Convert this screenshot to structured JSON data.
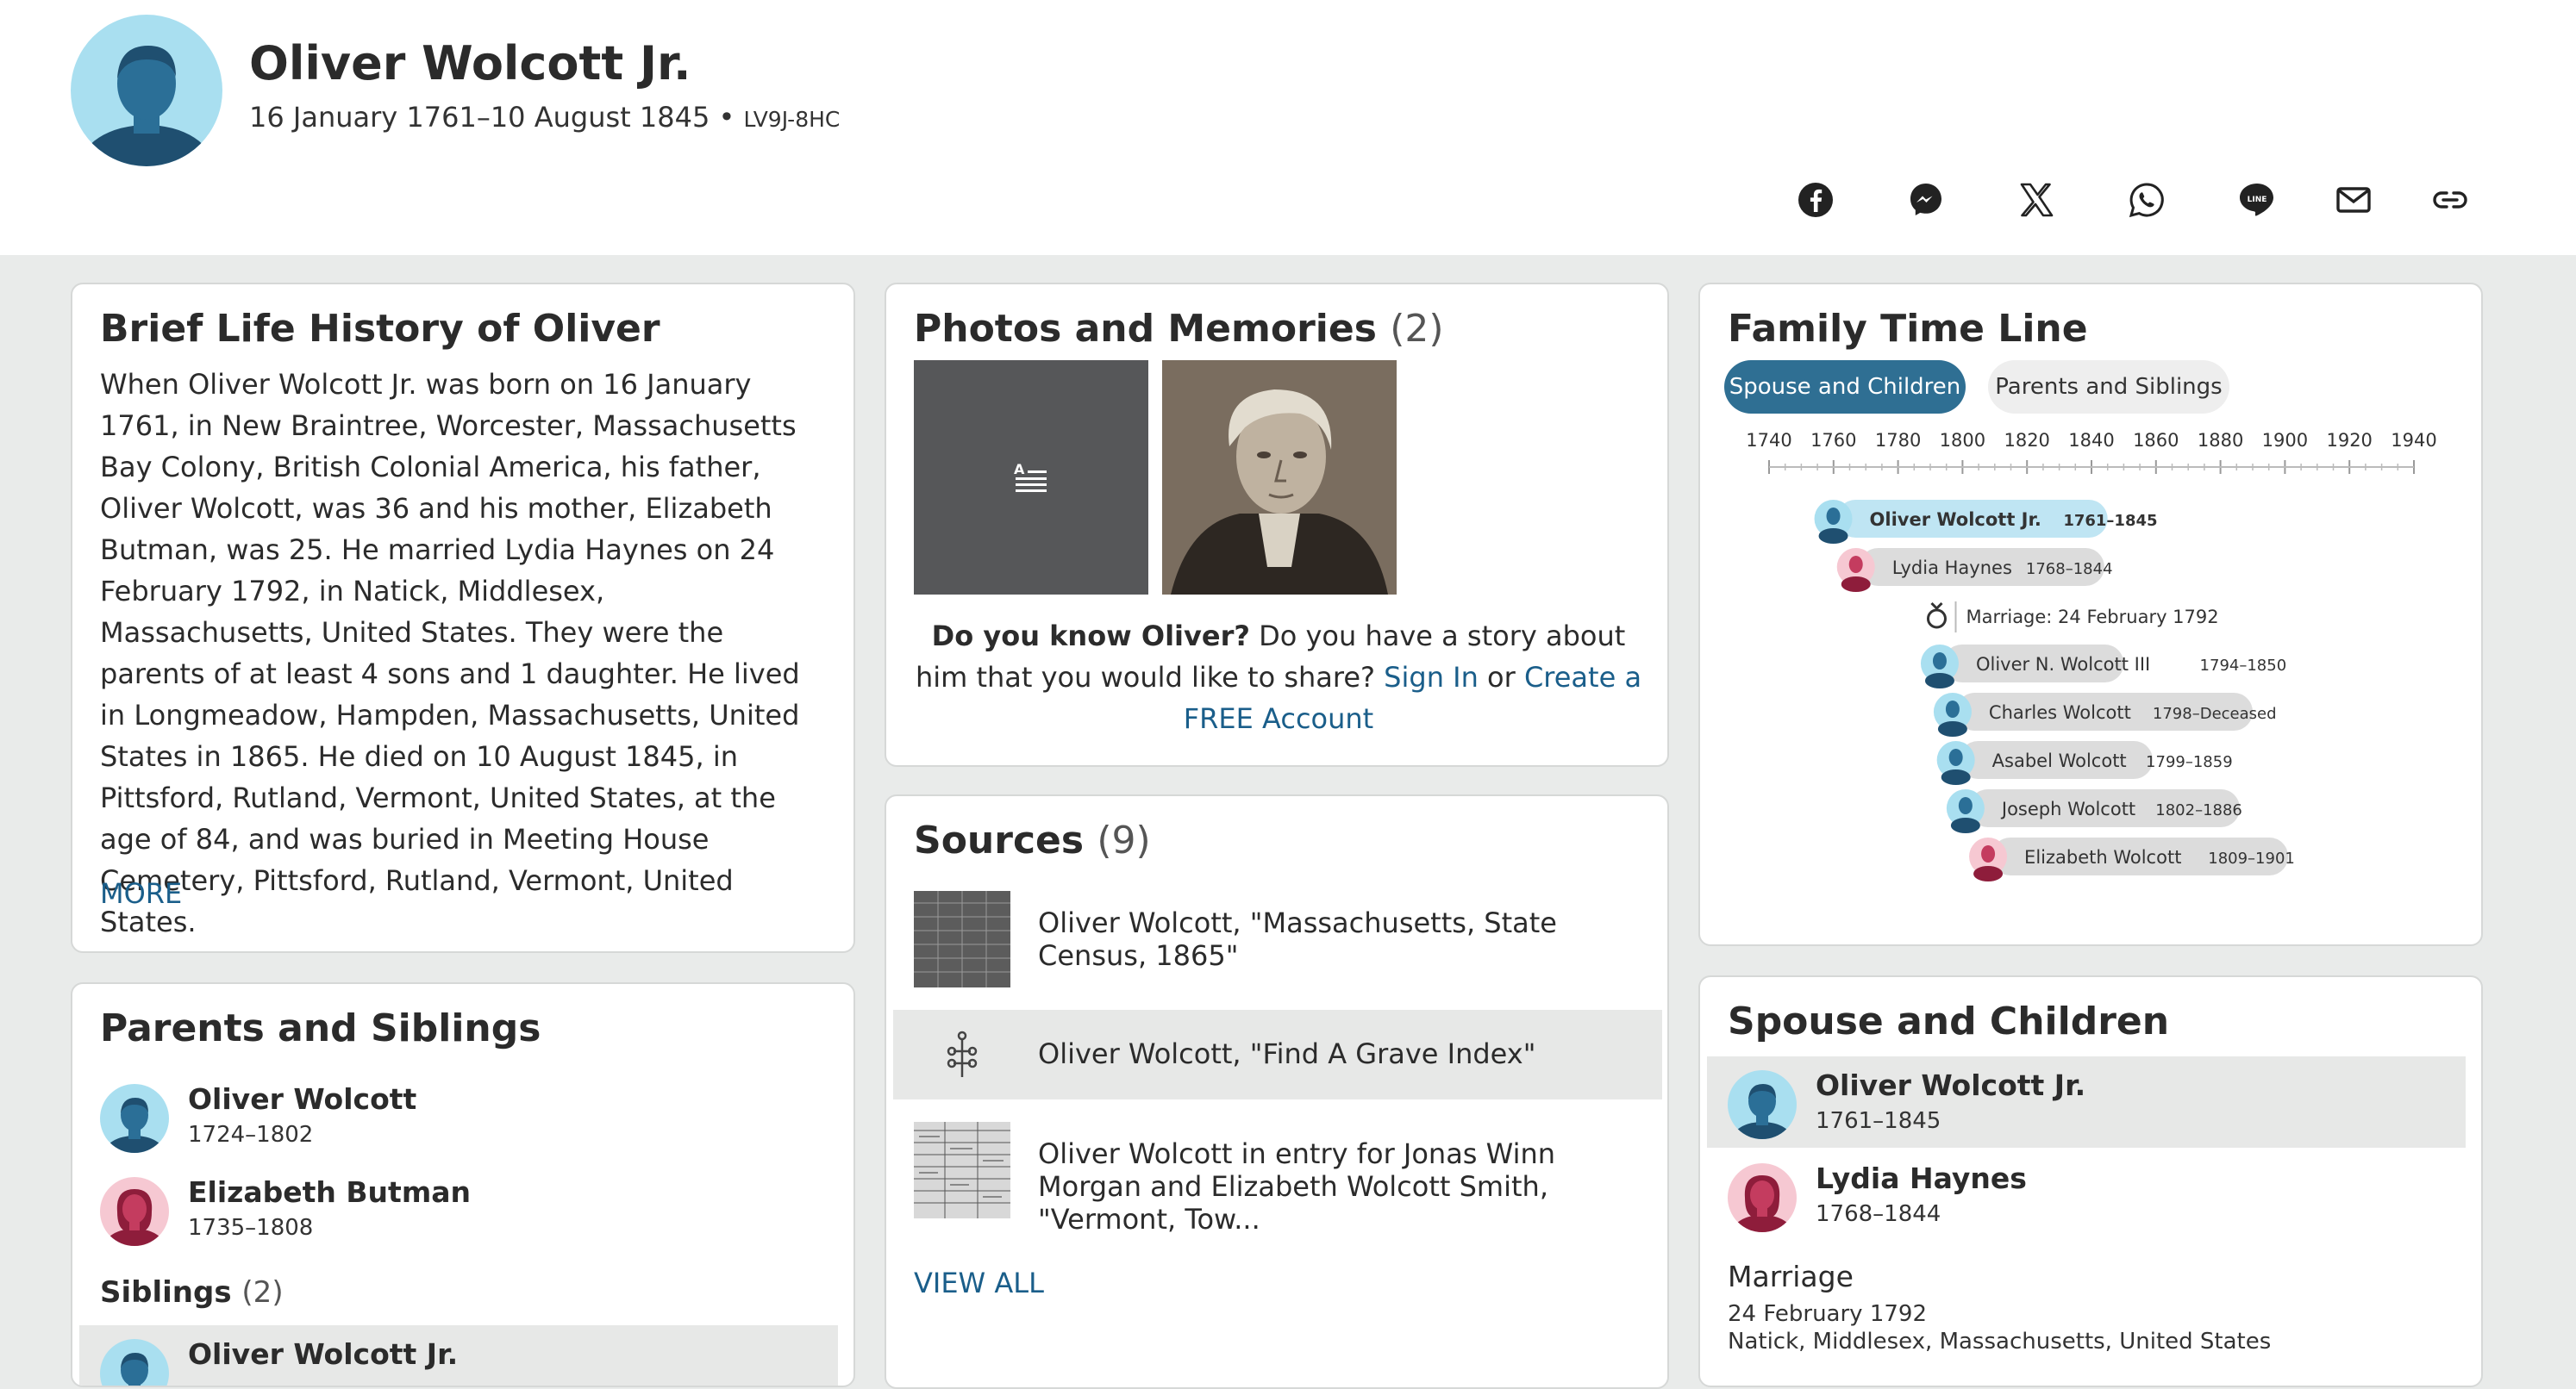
{
  "person": {
    "name": "Oliver Wolcott Jr.",
    "lifespan": "16 January 1761–10 August 1845",
    "separator": " • ",
    "pid": "LV9J-8HC"
  },
  "share": [
    "facebook-icon",
    "messenger-icon",
    "x-icon",
    "whatsapp-icon",
    "line-icon",
    "email-icon",
    "link-icon"
  ],
  "life_history": {
    "title": "Brief Life History of Oliver",
    "text": "When Oliver Wolcott Jr. was born on 16 January 1761, in New Braintree, Worcester, Massachusetts Bay Colony, British Colonial America, his father, Oliver Wolcott, was 36 and his mother, Elizabeth Butman, was 25. He married Lydia Haynes on 24 February 1792, in Natick, Middlesex, Massachusetts, United States. They were the parents of at least 4 sons and 1 daughter. He lived in Longmeadow, Hampden, Massachusetts, United States in 1865. He died on 10 August 1845, in Pittsford, Rutland, Vermont, United States, at the age of 84, and was buried in Meeting House Cemetery, Pittsford, Rutland, Vermont, United States.",
    "more": "MORE"
  },
  "photos": {
    "title": "Photos and Memories",
    "count": "(2)",
    "know_bold": "Do you know Oliver?",
    "know_text": " Do you have a story about him that you would like to share? ",
    "sign_in": "Sign In",
    "or": " or ",
    "create": "Create a FREE Account"
  },
  "sources": {
    "title": "Sources",
    "count": "(9)",
    "items": [
      "Oliver Wolcott, \"Massachusetts, State Census, 1865\"",
      "Oliver Wolcott, \"Find A Grave Index\"",
      "Oliver Wolcott in entry for Jonas Winn Morgan and Elizabeth Wolcott Smith, \"Vermont, Tow..."
    ],
    "view_all": "VIEW ALL"
  },
  "parents": {
    "title": "Parents and Siblings",
    "items": [
      {
        "name": "Oliver Wolcott",
        "dates": "1724–1802"
      },
      {
        "name": "Elizabeth Butman",
        "dates": "1735–1808"
      }
    ],
    "siblings_label": "Siblings",
    "siblings_count": "(2)",
    "sibling_first": {
      "name": "Oliver Wolcott Jr."
    }
  },
  "timeline": {
    "title": "Family Time Line",
    "tabs": [
      "Spouse and Children",
      "Parents and Siblings"
    ],
    "ticks": [
      1740,
      1760,
      1780,
      1800,
      1820,
      1840,
      1860,
      1880,
      1900,
      1920,
      1940
    ],
    "entries": [
      {
        "name": "Oliver Wolcott Jr.",
        "dates": "1761–1845",
        "start": 1761,
        "end": 1845,
        "gender": "m",
        "focus": true
      },
      {
        "name": "Lydia Haynes",
        "dates": "1768–1844",
        "start": 1768,
        "end": 1844,
        "gender": "f"
      },
      {
        "marriage": "Marriage: 24 February 1792",
        "year": 1792
      },
      {
        "name": "Oliver N. Wolcott III",
        "dates": "1794–1850",
        "start": 1794,
        "end": 1850,
        "gender": "m"
      },
      {
        "name": "Charles Wolcott",
        "dates": "1798–Deceased",
        "start": 1798,
        "end": 1890,
        "gender": "m"
      },
      {
        "name": "Asabel Wolcott",
        "dates": "1799–1859",
        "start": 1799,
        "end": 1859,
        "gender": "m"
      },
      {
        "name": "Joseph Wolcott",
        "dates": "1802–1886",
        "start": 1802,
        "end": 1886,
        "gender": "m"
      },
      {
        "name": "Elizabeth Wolcott",
        "dates": "1809–1901",
        "start": 1809,
        "end": 1901,
        "gender": "f"
      }
    ]
  },
  "spouse": {
    "title": "Spouse and Children",
    "items": [
      {
        "name": "Oliver Wolcott Jr.",
        "dates": "1761–1845"
      },
      {
        "name": "Lydia Haynes",
        "dates": "1768–1844"
      }
    ],
    "marriage_label": "Marriage",
    "marriage_date": "24 February 1792",
    "marriage_place": "Natick, Middlesex, Massachusetts, United States"
  },
  "colors": {
    "accent": "#2f6f93",
    "link": "#1a5e8a",
    "male_avatar_bg": "#a9dff0",
    "female_avatar_bg": "#f6c8d2",
    "male_bar": "#bfe5f3",
    "neutral_bar": "#dcdcdc"
  }
}
